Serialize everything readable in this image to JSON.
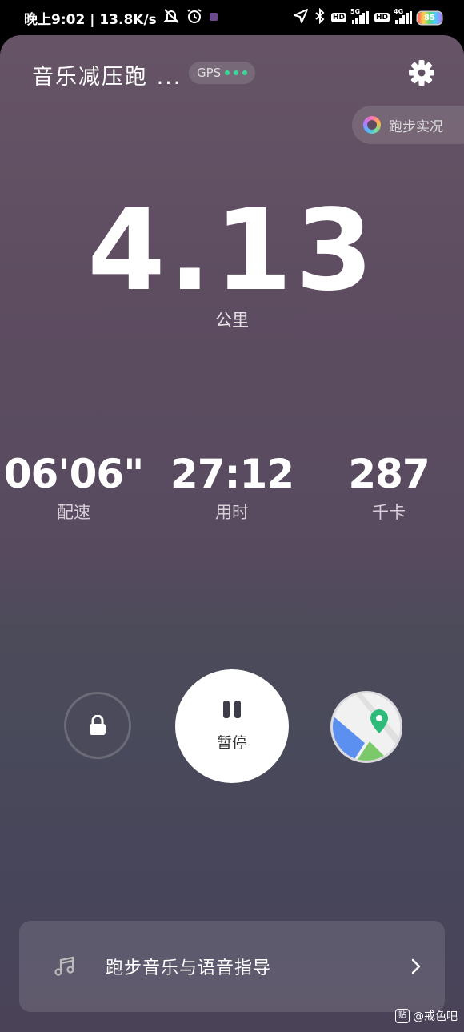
{
  "status_bar": {
    "time_and_speed": "晚上9:02 | 13.8K/s",
    "network_5g": "5G",
    "network_4g": "4G",
    "hd": "HD",
    "battery": "85"
  },
  "header": {
    "title": "音乐减压跑 ...",
    "gps_label": "GPS",
    "live_label": "跑步实况"
  },
  "distance": {
    "value": "4.13",
    "unit": "公里"
  },
  "stats": [
    {
      "value": "06'06\"",
      "label": "配速"
    },
    {
      "value": "27:12",
      "label": "用时"
    },
    {
      "value": "287",
      "label": "千卡"
    }
  ],
  "controls": {
    "pause_label": "暂停"
  },
  "music_bar": {
    "label": "跑步音乐与语音指导"
  },
  "watermark": {
    "icon_text": "贴",
    "text": "@戒色吧"
  },
  "colors": {
    "accent_green": "#3ed79a",
    "background_top": "#665466",
    "background_bottom": "#4a4358"
  }
}
